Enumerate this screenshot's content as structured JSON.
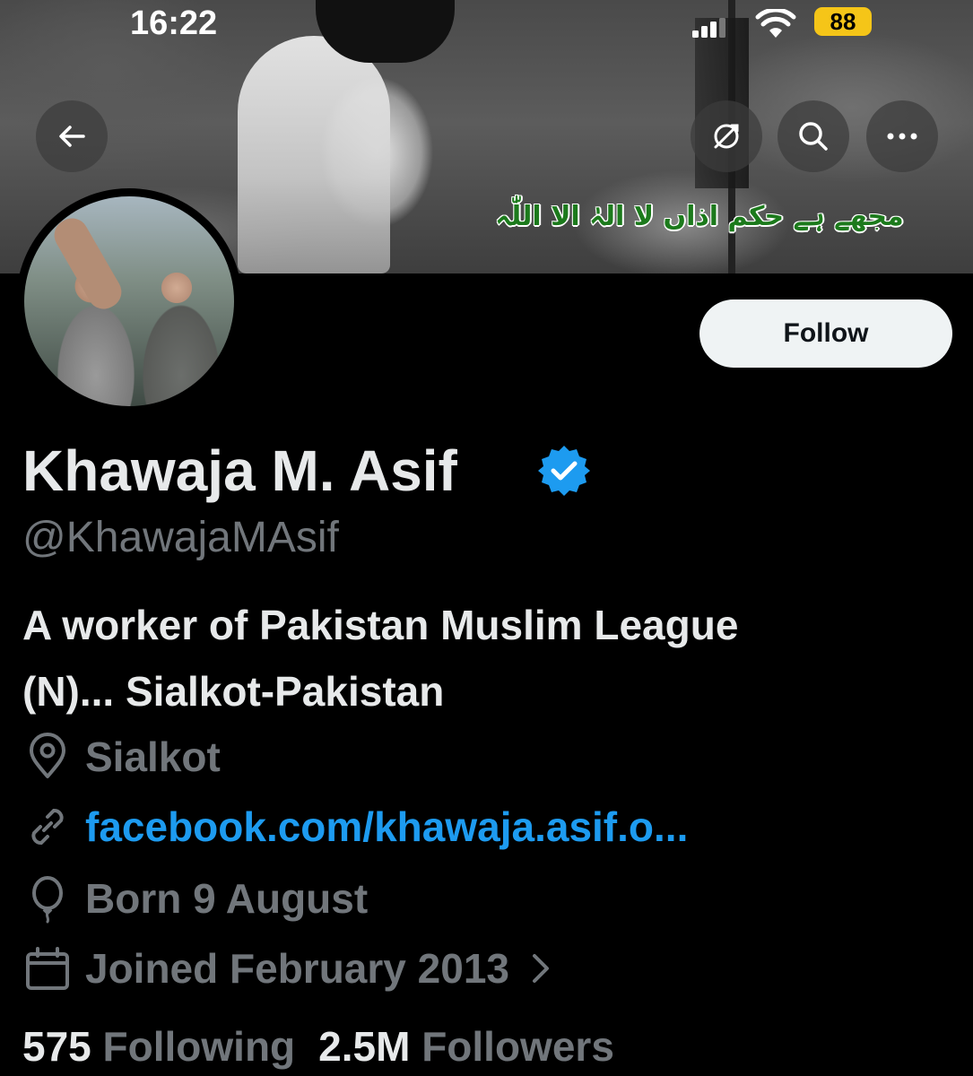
{
  "status_bar": {
    "time": "16:22",
    "battery": "88"
  },
  "banner": {
    "urdu_text": "مجھے ہے حکم اذاں لا الہٰ الا اللّٰہ"
  },
  "header": {
    "follow_label": "Follow"
  },
  "profile": {
    "name": "Khawaja M. Asif",
    "handle": "@KhawajaMAsif",
    "bio_line1": "A worker of Pakistan Muslim League",
    "bio_line2": "(N)... Sialkot-Pakistan",
    "location": "Sialkot",
    "website": "facebook.com/khawaja.asif.o...",
    "born": "Born 9 August",
    "joined": "Joined February 2013"
  },
  "stats": {
    "following_count": "575",
    "following_label": "Following",
    "followers_count": "2.5M",
    "followers_label": "Followers"
  },
  "colors": {
    "background": "#000000",
    "text_primary": "#e7e9ea",
    "text_secondary": "#71767b",
    "link": "#1d9bf0",
    "verified": "#1d9bf0",
    "follow_bg": "#eff3f4",
    "battery": "#f5c518"
  },
  "icons": [
    "back-arrow-icon",
    "translate-icon",
    "search-icon",
    "more-icon",
    "verified-badge-icon",
    "location-icon",
    "link-icon",
    "balloon-icon",
    "calendar-icon",
    "chevron-right-icon"
  ]
}
